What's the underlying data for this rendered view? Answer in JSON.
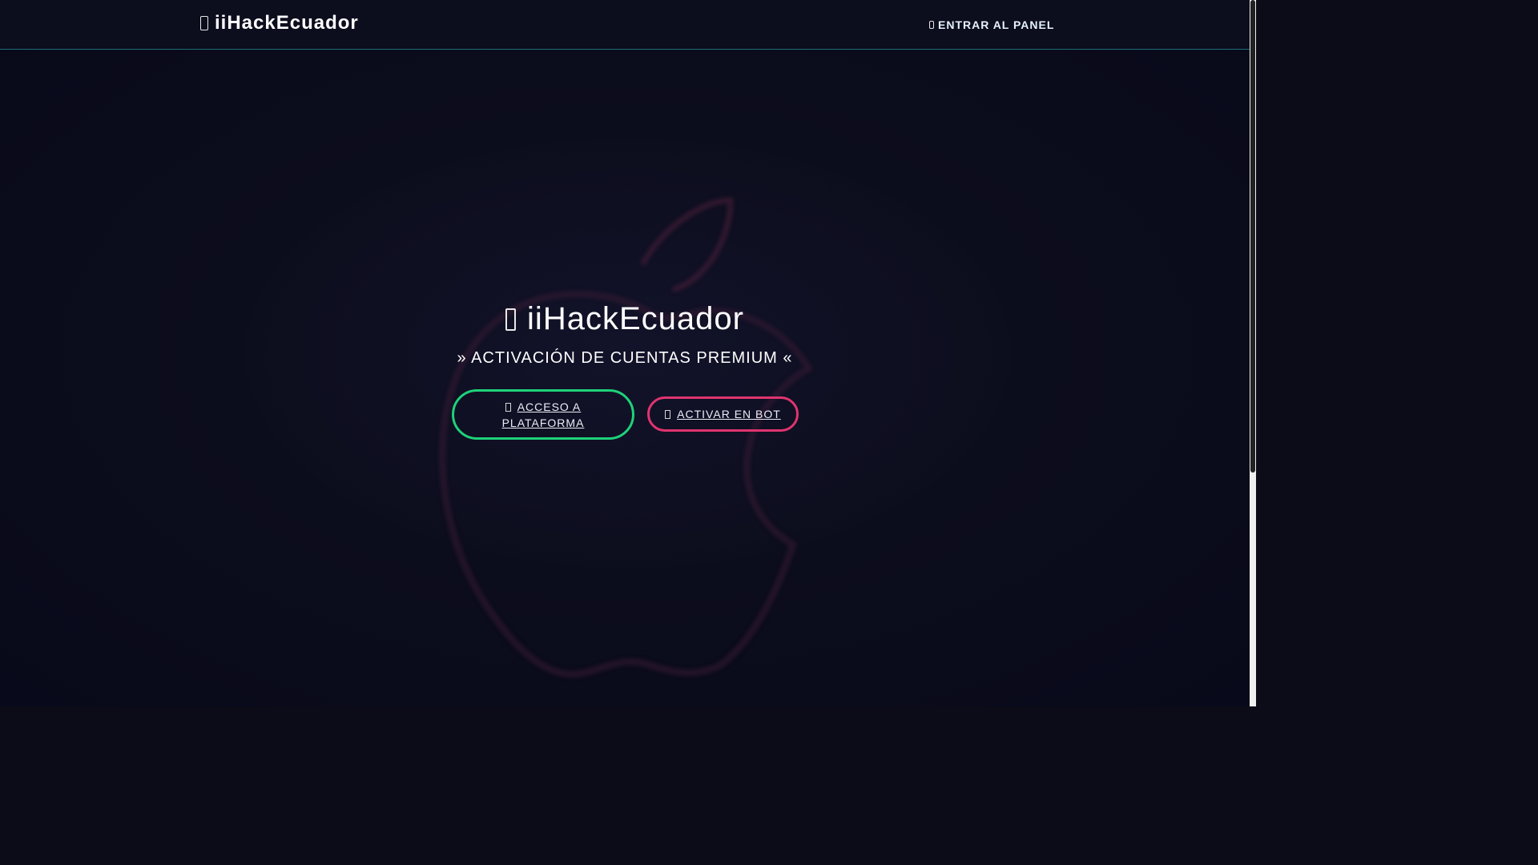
{
  "navbar": {
    "brand_text": "iiHackEcuador",
    "brand_icon": "apple-icon",
    "panel_link_label": "ENTRAR AL PANEL",
    "panel_link_icon": "login-icon"
  },
  "hero": {
    "title": "iiHackEcuador",
    "title_icon": "apple-icon",
    "subtitle": "» ACTIVACIÓN DE CUENTAS PREMIUM «",
    "buttons": [
      {
        "label_line1": "ACCESO A",
        "label_line2": "PLATAFORMA",
        "icon": "globe-icon"
      },
      {
        "label": "ACTIVAR EN BOT",
        "icon": "robot-icon"
      }
    ]
  },
  "colors": {
    "background": "#0b0c18",
    "accent_green": "#1ed27a",
    "accent_pink": "#e0346f",
    "navbar_border": "#1f6b7a"
  }
}
